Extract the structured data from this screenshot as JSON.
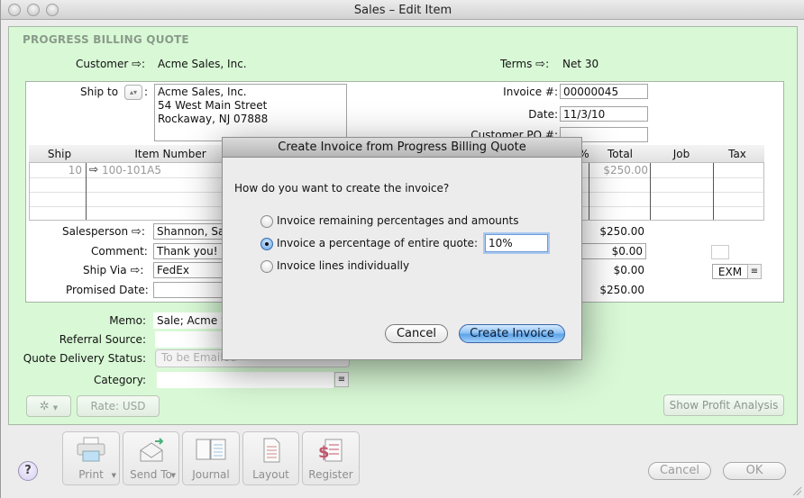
{
  "window": {
    "title": "Sales – Edit Item",
    "controls": [
      "close",
      "minimize",
      "zoom"
    ]
  },
  "form": {
    "doc_type": "PROGRESS BILLING QUOTE",
    "customer_label": "Customer",
    "customer_value": "Acme Sales, Inc.",
    "terms_label": "Terms",
    "terms_value": "Net 30",
    "ship_to_label": "Ship to",
    "ship_to_lines": [
      "Acme Sales, Inc.",
      "54 West Main Street",
      "Rockaway, NJ 07888"
    ],
    "invoice_no_label": "Invoice #:",
    "invoice_no_value": "00000045",
    "date_label": "Date:",
    "date_value": "11/3/10",
    "customer_po_label": "Customer PO #:",
    "customer_po_value": "",
    "colon": ":",
    "arrow": "⇨"
  },
  "grid": {
    "columns": [
      "Ship",
      "Item Number",
      "%",
      "Total",
      "Job",
      "Tax"
    ],
    "rows": [
      {
        "ship": "10",
        "item_number": "100-101A5",
        "total": "$250.00",
        "job": "",
        "tax": ""
      }
    ]
  },
  "lower_left": {
    "salesperson_label": "Salesperson",
    "salesperson_value": "Shannon, Sar",
    "comment_label": "Comment:",
    "comment_value": "Thank you!",
    "ship_via_label": "Ship Via",
    "ship_via_value": "FedEx",
    "promised_date_label": "Promised Date:",
    "promised_date_value": ""
  },
  "totals": {
    "subtotal": "$250.00",
    "freight": "$0.00",
    "tax": "$0.00",
    "total": "$250.00",
    "freight_tax_code": "EXM"
  },
  "footer_fields": {
    "memo_label": "Memo:",
    "memo_value": "Sale; Acme S",
    "referral_label": "Referral Source:",
    "referral_value": "",
    "delivery_label": "Quote Delivery Status:",
    "delivery_value": "To be Emailed",
    "category_label": "Category:",
    "category_value": ""
  },
  "buttons": {
    "rate": "Rate:  USD",
    "profit_analysis": "Show Profit Analysis",
    "cancel": "Cancel",
    "ok": "OK",
    "help": "?"
  },
  "toolbar": [
    {
      "label": "Print",
      "icon": "printer-icon",
      "has_menu": true
    },
    {
      "label": "Send To",
      "icon": "envelope-send-icon",
      "has_menu": true
    },
    {
      "label": "Journal",
      "icon": "journal-book-icon",
      "has_menu": false
    },
    {
      "label": "Layout",
      "icon": "layout-page-icon",
      "has_menu": false
    },
    {
      "label": "Register",
      "icon": "register-dollar-icon",
      "has_menu": false
    }
  ],
  "dialog": {
    "title": "Create Invoice from Progress Billing Quote",
    "question": "How do you want to create the invoice?",
    "options": [
      {
        "label": "Invoice remaining percentages and amounts",
        "selected": false
      },
      {
        "label": "Invoice a percentage of entire quote:",
        "selected": true
      },
      {
        "label": "Invoice lines individually",
        "selected": false
      }
    ],
    "percentage_value": "10%",
    "cancel_label": "Cancel",
    "create_label": "Create Invoice"
  },
  "colors": {
    "form_background": "#d9f9d6",
    "accent_blue": "#5ea3e7"
  }
}
